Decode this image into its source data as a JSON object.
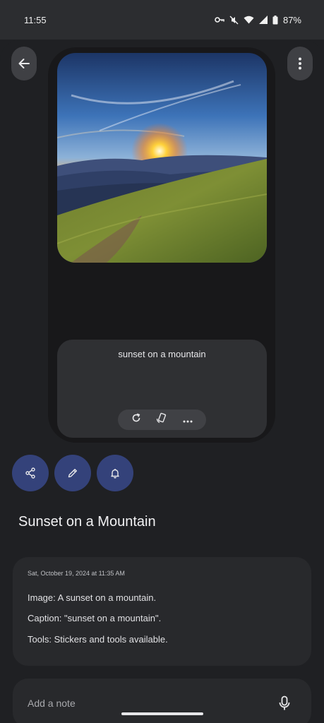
{
  "status_bar": {
    "time": "11:55",
    "battery_percent": "87%",
    "icons": [
      "vpn-key-icon",
      "mute-icon",
      "wifi-icon",
      "signal-icon",
      "battery-icon"
    ]
  },
  "toolbar": {
    "back_icon": "arrow-left-icon",
    "more_icon": "more-vert-icon"
  },
  "preview": {
    "image_subject": "sunset over mountains",
    "caption": "sunset on a mountain",
    "tools": [
      "refresh-icon",
      "rotate-device-icon",
      "more-horiz-icon"
    ]
  },
  "actions": [
    "share-icon",
    "edit-icon",
    "bell-icon"
  ],
  "memory": {
    "title": "Sunset on a Mountain",
    "date": "Sat, October 19, 2024 at 11:35 AM",
    "lines": [
      "Image: A sunset on a mountain.",
      "Caption: \"sunset on a mountain\".",
      "Tools: Stickers and tools available."
    ]
  },
  "note": {
    "placeholder": "Add a note"
  },
  "colors": {
    "background": "#1f2023",
    "accent_button": "#34427a"
  }
}
